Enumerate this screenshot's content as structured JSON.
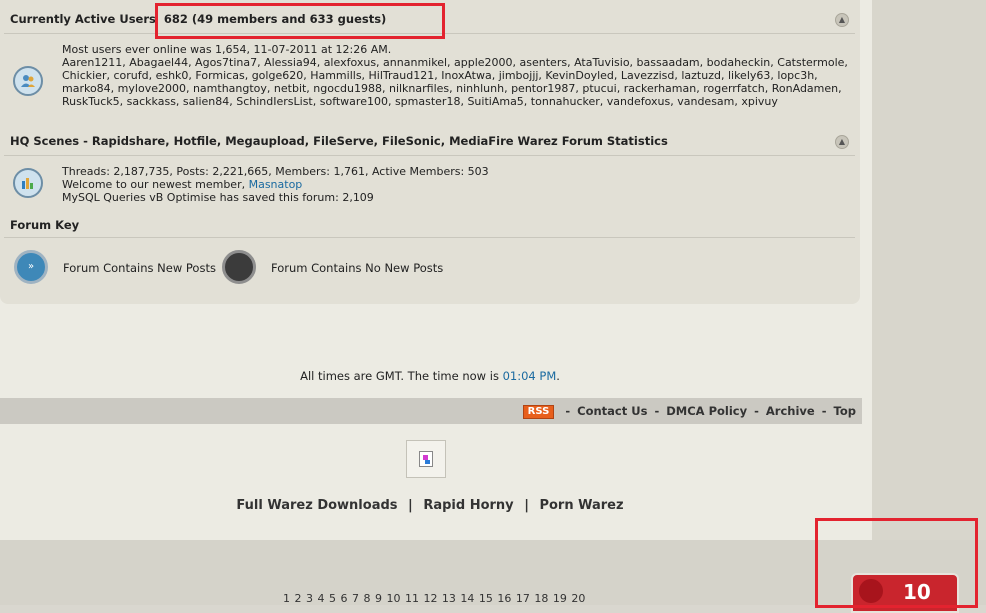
{
  "active_users": {
    "title": "Currently Active Users",
    "count": "682 (49 members and 633 guests)",
    "most_ever": "Most users ever online was 1,654, 11-07-2011 at 12:26 AM.",
    "members": "Aaren1211, Abagael44, Agos7tina7, Alessia94, alexfoxus, annanmikel, apple2000, asenters, AtaTuvisio, bassaadam, bodaheckin, Catstermole, Chickier, corufd, eshk0, Formicas, golge620, Hammills, HilTraud121, InoxAtwa, jimbojjj, KevinDoyled, Lavezzisd, laztuzd, likely63, lopc3h, marko84, mylove2000, namthangtoy, netbit, ngocdu1988, nilknarfiles, ninhlunh, pentor1987, ptucui, rackerhaman, rogerrfatch, RonAdamen, RuskTuck5, sackkass, salien84, SchindIersList, software100, spmaster18, SuitiAma5, tonnahucker, vandefoxus, vandesam, xpivuy"
  },
  "statistics": {
    "title": "HQ Scenes - Rapidshare, Hotfile, Megaupload, FileServe, FileSonic, MediaFire Warez Forum Statistics",
    "counts": "Threads: 2,187,735, Posts: 2,221,665, Members: 1,761, Active Members: 503",
    "welcome_prefix": "Welcome to our newest member,",
    "newest_member": "Masnatop",
    "mysql": "MySQL Queries vB Optimise has saved this forum: 2,109"
  },
  "forum_key": {
    "title": "Forum Key",
    "new_posts": "Forum Contains New Posts",
    "no_new_posts": "Forum Contains No New Posts"
  },
  "time": {
    "prefix": "All times are GMT. The time now is",
    "now": "01:04 PM",
    "suffix": "."
  },
  "footer": {
    "rss": "RSS",
    "sep": "-",
    "links": [
      "Contact Us",
      "DMCA Policy",
      "Archive",
      "Top"
    ]
  },
  "promo": {
    "sep": "|",
    "links": [
      "Full Warez Downloads",
      "Rapid Horny",
      "Porn Warez"
    ]
  },
  "pagination": "1 2 3 4 5 6 7 8 9 10 11 12 13 14 15 16 17 18 19 20",
  "counter": {
    "value": "10"
  },
  "colors": {
    "highlight": "#e3232f",
    "link_blue": "#1a6aa0",
    "rss_orange": "#e85f1c"
  }
}
